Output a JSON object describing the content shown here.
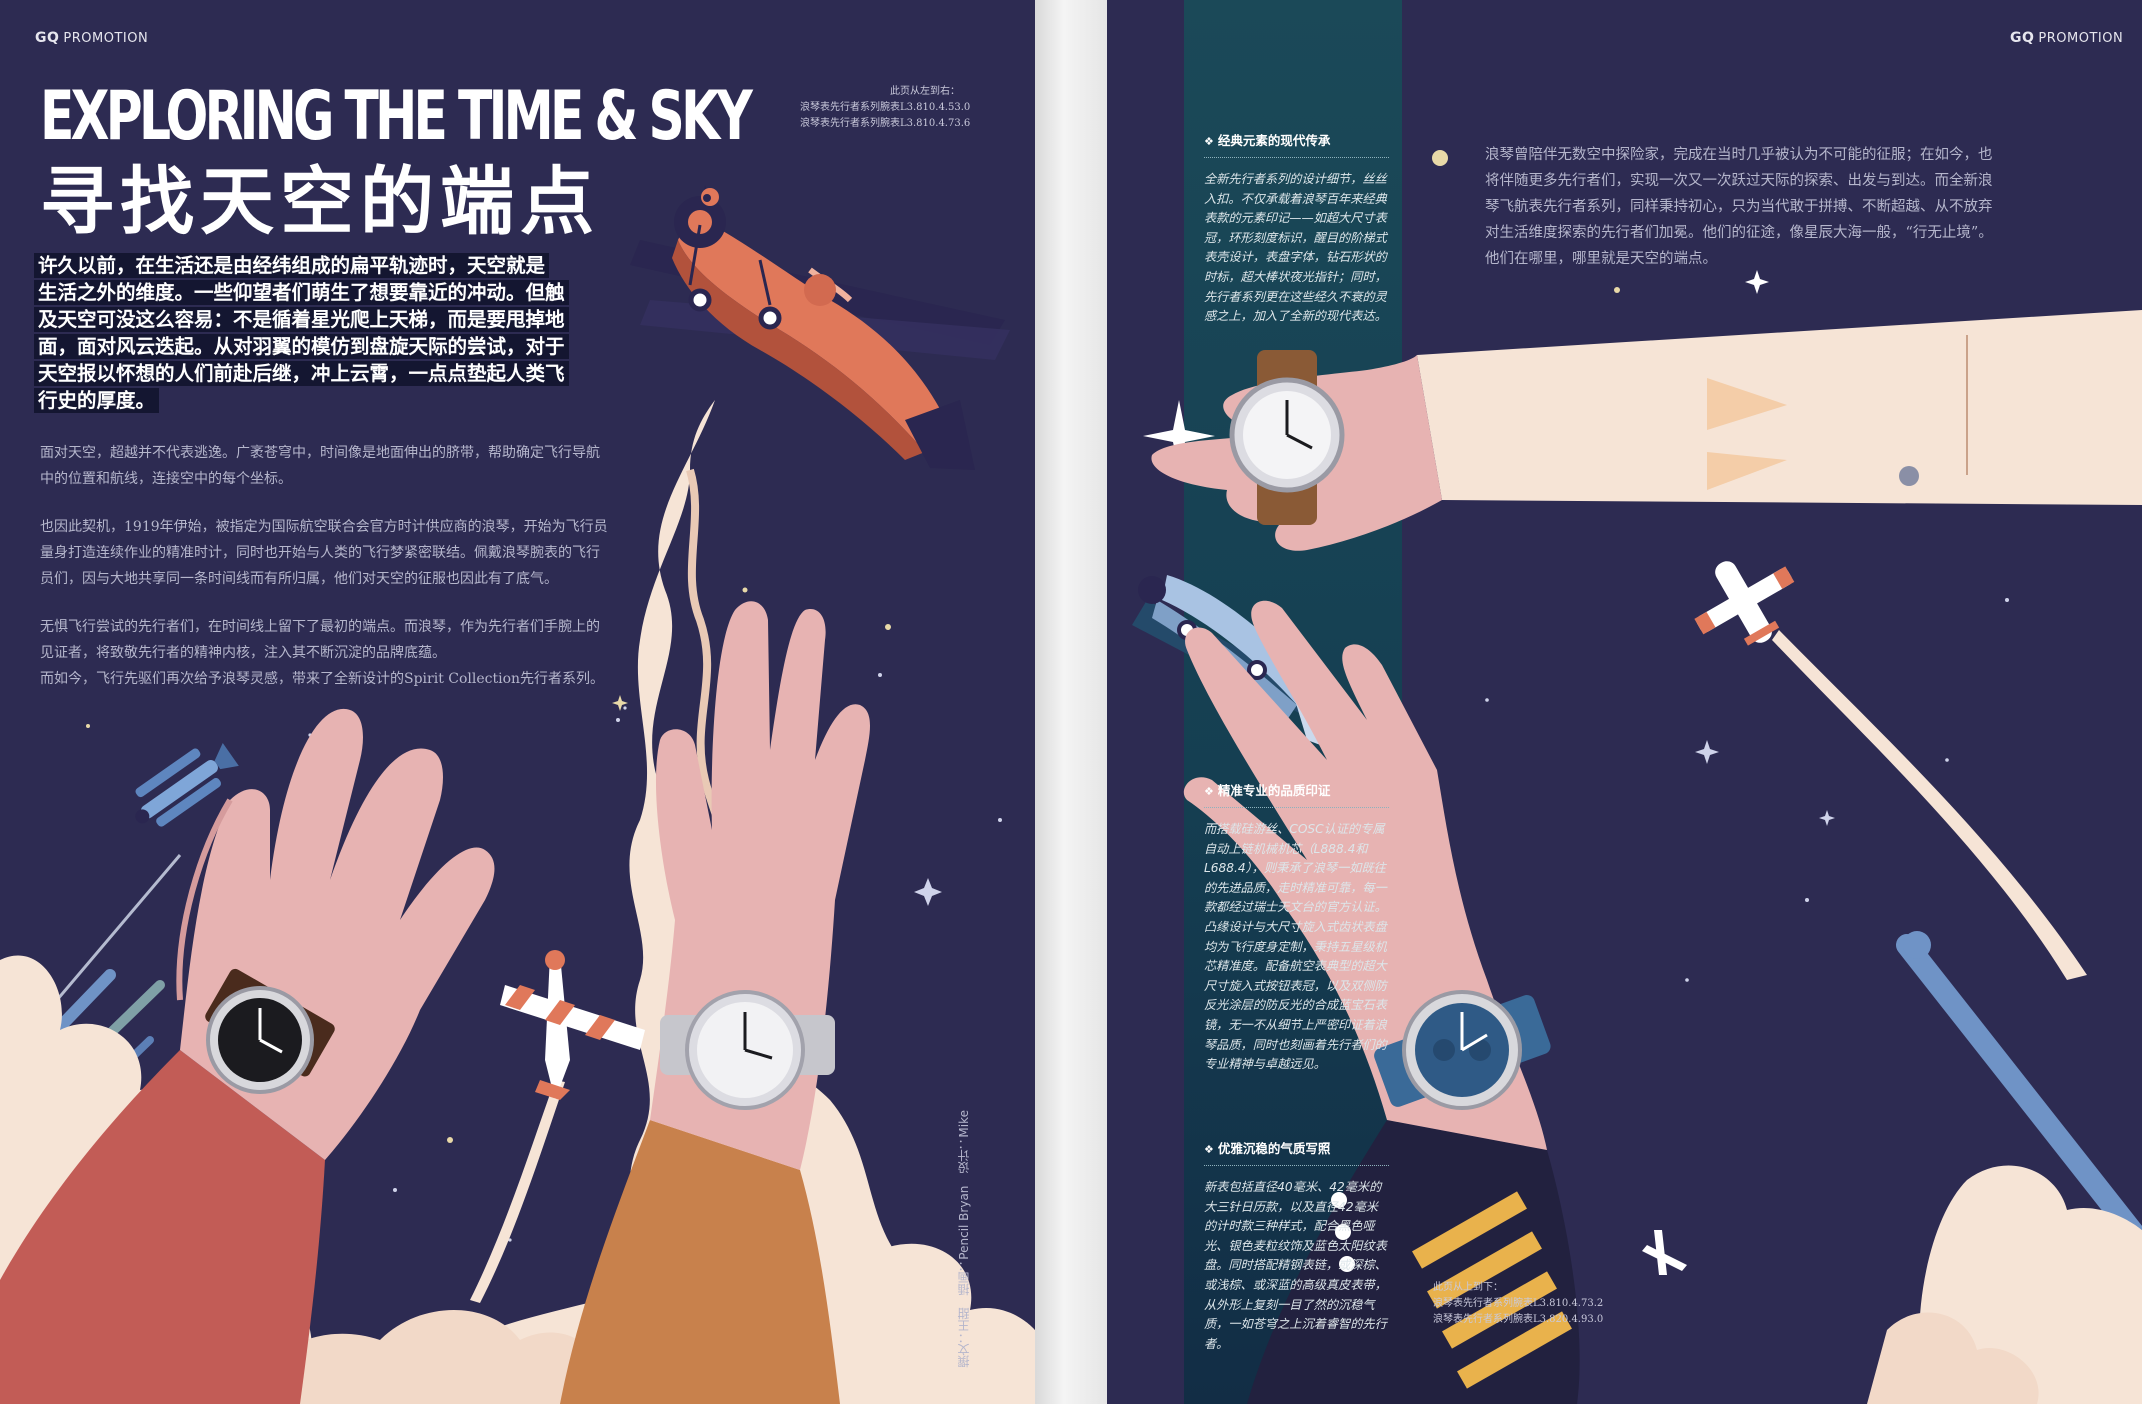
{
  "spread": {
    "left_page": {
      "brand": {
        "logo": "GQ",
        "label": "PROMOTION"
      },
      "top_caption": [
        "此页从左到右：",
        "浪琴表先行者系列腕表L3.810.4.53.0",
        "浪琴表先行者系列腕表L3.810.4.73.6"
      ],
      "title_en": "EXPLORING THE TIME & SKY",
      "title_zh": "寻找天空的端点",
      "intro_lines": [
        "许久以前，在生活还是由经纬组成的扁平轨迹时，天空就是",
        "生活之外的维度。一些仰望者们萌生了想要靠近的冲动。但触",
        "及天空可没这么容易：不是循着星光爬上天梯，而是要甩掉地",
        "面，面对风云迭起。从对羽翼的模仿到盘旋天际的尝试，对于",
        "天空报以怀想的人们前赴后继，冲上云霄，一点点垫起人类飞",
        "行史的厚度。"
      ],
      "body_paragraphs": [
        "面对天空，超越并不代表逃逸。广袤苍穹中，时间像是地面伸出的脐带，帮助确定飞行导航中的位置和航线，连接空中的每个坐标。",
        "也因此契机，1919年伊始，被指定为国际航空联合会官方时计供应商的浪琴，开始为飞行员量身打造连续作业的精准时计，同时也开始与人类的飞行梦紧密联结。佩戴浪琴腕表的飞行员们，因与大地共享同一条时间线而有所归属，他们对天空的征服也因此有了底气。",
        "无惧飞行尝试的先行者们，在时间线上留下了最初的端点。而浪琴，作为先行者们手腕上的见证者，将致敬先行者的精神内核，注入其不断沉淀的品牌底蕴。",
        "而如今，飞行先驱们再次给予浪琴灵感，带来了全新设计的Spirit Collection先行者系列。"
      ],
      "vertical_credit": "撰文：王甜　插画：Pencil Bryan　设计：Mike"
    },
    "right_page": {
      "brand": {
        "logo": "GQ",
        "label": "PROMOTION"
      },
      "sections": [
        {
          "title": "经典元素的现代传承",
          "body": "全新先行者系列的设计细节，丝丝入扣。不仅承载着浪琴百年来经典表款的元素印记——如超大尺寸表冠，环形刻度标识，醒目的阶梯式表壳设计，表盘字体，钻石形状的时标，超大棒状夜光指针；同时，先行者系列更在这些经久不衰的灵感之上，加入了全新的现代表达。"
        },
        {
          "title": "精准专业的品质印证",
          "body": "而搭载硅游丝、COSC认证的专属自动上链机械机芯（L888.4和L688.4），则秉承了浪琴一如既往的先进品质，走时精准可靠，每一款都经过瑞士天文台的官方认证。凸缘设计与大尺寸旋入式齿状表盘均为飞行度身定制，秉持五星级机芯精准度。配备航空表典型的超大尺寸旋入式按钮表冠，以及双侧防反光涂层的防反光的合成蓝宝石表镜，无一不从细节上严密印证着浪琴品质，同时也刻画着先行者们的专业精神与卓越远见。"
        },
        {
          "title": "优雅沉稳的气质写照",
          "body": "新表包括直径40毫米、42毫米的大三针日历款，以及直径42毫米的计时款三种样式，配合黑色哑光、银色麦粒纹饰及蓝色太阳纹表盘。同时搭配精钢表链，或深棕、或浅棕、或深蓝的高级真皮表带，从外形上复刻一目了然的沉稳气质，一如苍穹之上沉着睿智的先行者。"
        }
      ],
      "intro_text": "浪琴曾陪伴无数空中探险家，完成在当时几乎被认为不可能的征服；在如今，也将伴随更多先行者们，实现一次又一次跃过天际的探索、出发与到达。而全新浪琴飞航表先行者系列，同样秉持初心，只为当代敢于拼搏、不断超越、从不放弃对生活维度探索的先行者们加冕。他们的征途，像星辰大海一般，“行无止境”。他们在哪里，哪里就是天空的端点。",
      "bottom_caption": [
        "此页从上到下：",
        "浪琴表先行者系列腕表L3.810.4.73.2",
        "浪琴表先行者系列腕表L3.820.4.93.0"
      ]
    }
  },
  "colors": {
    "navy": "#2d2b52",
    "teal": "#1b4958",
    "skin": "#e7b3b2",
    "cream": "#f6e4d6",
    "plane_orange": "#e0785a",
    "plane_blue": "#8fb0d4"
  }
}
